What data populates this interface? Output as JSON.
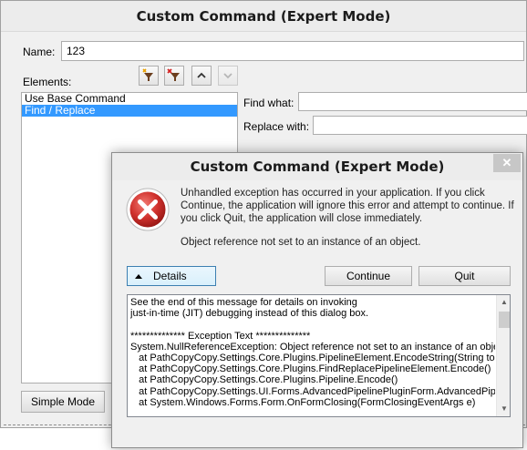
{
  "main_window": {
    "title": "Custom Command (Expert Mode)",
    "name_label": "Name:",
    "name_value": "123",
    "elements_label": "Elements:",
    "toolbar": {
      "add_icon": "add-filter-icon",
      "remove_icon": "remove-filter-icon",
      "up_icon": "chevron-up-icon",
      "down_icon": "chevron-down-icon"
    },
    "elements": [
      {
        "label": "Use Base Command",
        "selected": false
      },
      {
        "label": "Find / Replace",
        "selected": true
      }
    ],
    "find_label": "Find what:",
    "find_value": "",
    "replace_label": "Replace with:",
    "replace_value": "",
    "simple_mode_label": "Simple Mode"
  },
  "error_dialog": {
    "title": "Custom Command (Expert Mode)",
    "close_glyph": "✕",
    "message": "Unhandled exception has occurred in your application. If you click Continue, the application will ignore this error and attempt to continue. If you click Quit, the application will close immediately.",
    "detail_message": "Object reference not set to an instance of an object.",
    "details_label": "Details",
    "continue_label": "Continue",
    "quit_label": "Quit",
    "details_lines": [
      "See the end of this message for details on invoking",
      "just-in-time (JIT) debugging instead of this dialog box.",
      "",
      "************** Exception Text **************",
      "System.NullReferenceException: Object reference not set to an instance of an object.",
      "   at PathCopyCopy.Settings.Core.Plugins.PipelineElement.EncodeString(String toEncode)",
      "   at PathCopyCopy.Settings.Core.Plugins.FindReplacePipelineElement.Encode()",
      "   at PathCopyCopy.Settings.Core.Plugins.Pipeline.Encode()",
      "   at PathCopyCopy.Settings.UI.Forms.AdvancedPipelinePluginForm.AdvancedPipelinePluginForm_FormClosing(Object sender, FormClosingEventArgs e)",
      "   at System.Windows.Forms.Form.OnFormClosing(FormClosingEventArgs e)"
    ]
  },
  "colors": {
    "selection": "#3399ff",
    "error_icon": "#d0312d",
    "dialog_bg": "#f0f0f0"
  }
}
